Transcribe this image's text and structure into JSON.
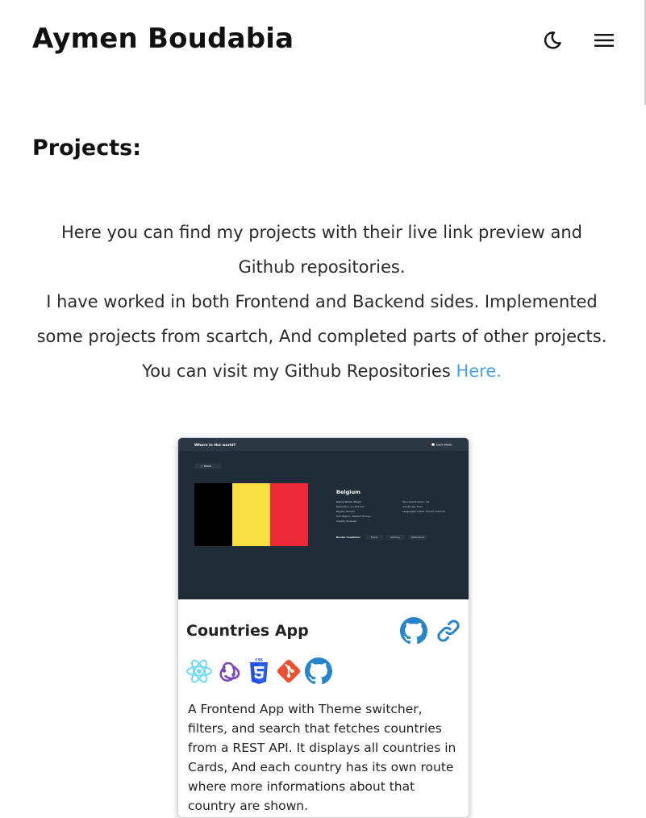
{
  "header": {
    "site_name": "Aymen Boudabia",
    "theme_icon": "moon-icon",
    "menu_icon": "hamburger-menu-icon"
  },
  "projects_section": {
    "title": "Projects:",
    "intro_line_1": "Here you can find my projects with their live link preview and Github repositories.",
    "intro_line_2": "I have worked in both Frontend and Backend sides. Implemented some projects from scartch, And completed parts of other projects.",
    "intro_line_3": "You can visit my Github Repositories",
    "repos_link_label": "Here."
  },
  "project_card": {
    "preview": {
      "app_title": "Where in the world?",
      "dark_mode_label": "Dark Mode",
      "back_label": "Back",
      "country_name": "Belgium",
      "details_left": [
        "Native Name: België",
        "Population: 11,319,511",
        "Region: Europe",
        "Sub Region: Western Europe",
        "Capital: Brussels"
      ],
      "details_right": [
        "Top Level Domain: .be",
        "Currencies: Euro",
        "Languages: Dutch, French, German"
      ],
      "border_label": "Border Countries:",
      "border_countries": [
        "France",
        "Germany",
        "Netherlands"
      ],
      "flag_colors": [
        "#000000",
        "#fae042",
        "#ed2939"
      ]
    },
    "title": "Countries App",
    "github_icon": "github-icon",
    "live_link_icon": "link-icon",
    "tech_icons": [
      "react-icon",
      "redux-icon",
      "css3-icon",
      "git-icon",
      "github-icon"
    ],
    "description": "A Frontend App with Theme switcher, filters, and search that fetches countries from a REST API. It displays all countries in Cards, And each country has its own route where more informations about that country are shown."
  },
  "colors": {
    "link": "#4aa3e6",
    "react": "#61dafb",
    "redux": "#764abc",
    "css3": "#264de4",
    "git": "#f05032",
    "preview_bg": "#2b3743"
  }
}
